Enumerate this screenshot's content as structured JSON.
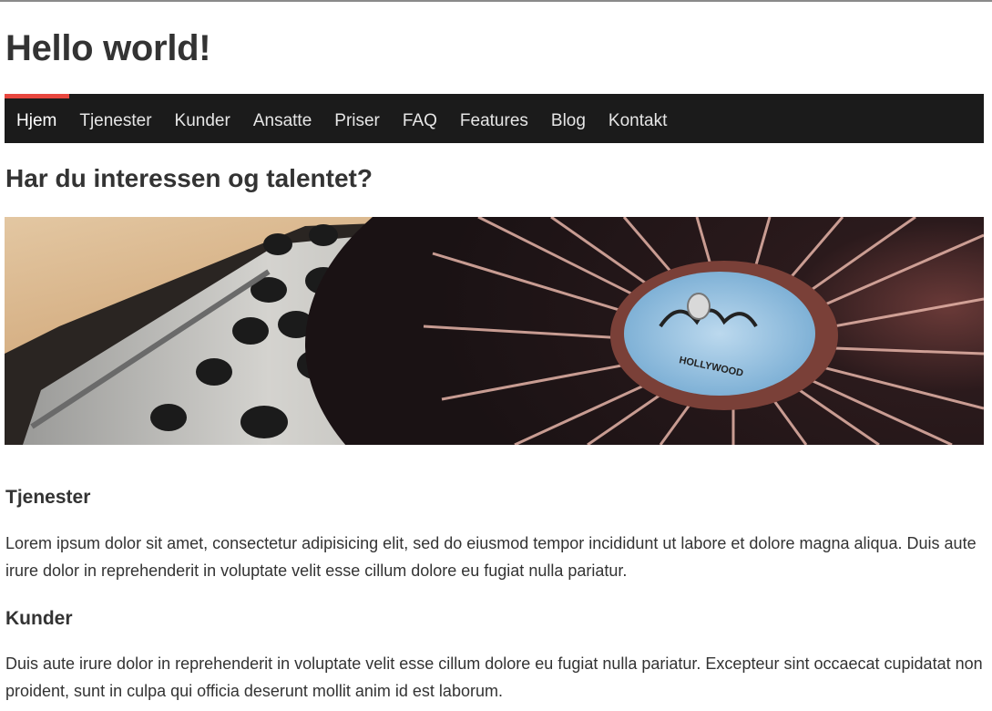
{
  "site": {
    "title": "Hello world!"
  },
  "nav": {
    "active_color": "#e8473f",
    "items": [
      {
        "label": "Hjem",
        "active": true
      },
      {
        "label": "Tjenester"
      },
      {
        "label": "Kunder"
      },
      {
        "label": "Ansatte"
      },
      {
        "label": "Priser"
      },
      {
        "label": "FAQ"
      },
      {
        "label": "Features"
      },
      {
        "label": "Blog"
      },
      {
        "label": "Kontakt"
      }
    ]
  },
  "hero": {
    "heading": "Har du interessen og talentet?",
    "label_text": "HOLLYWOOD"
  },
  "sections": [
    {
      "title": "Tjenester",
      "text": "Lorem ipsum dolor sit amet, consectetur adipisicing elit, sed do eiusmod tempor incididunt ut labore et dolore magna aliqua. Duis aute irure dolor in reprehenderit in voluptate velit esse cillum dolore eu fugiat nulla pariatur."
    },
    {
      "title": "Kunder",
      "text": "Duis aute irure dolor in reprehenderit in voluptate velit esse cillum dolore eu fugiat nulla pariatur. Excepteur sint occaecat cupidatat non proident, sunt in culpa qui officia deserunt mollit anim id est laborum."
    }
  ]
}
